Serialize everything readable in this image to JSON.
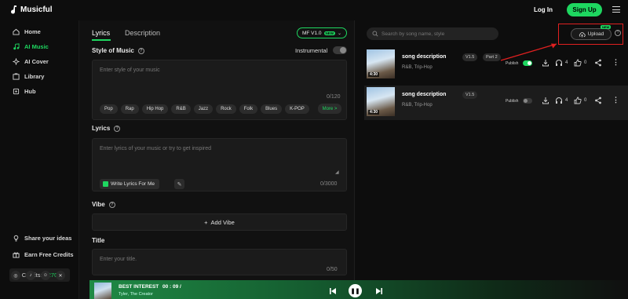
{
  "app": {
    "name": "Musicful"
  },
  "header": {
    "login": "Log In",
    "signup": "Sign Up"
  },
  "sidebar": {
    "items": [
      {
        "label": "Home",
        "icon": "home-icon",
        "active": false
      },
      {
        "label": "AI Music",
        "icon": "music-icon",
        "active": true
      },
      {
        "label": "AI Cover",
        "icon": "cover-icon",
        "active": false
      },
      {
        "label": "Library",
        "icon": "library-icon",
        "active": false
      },
      {
        "label": "Hub",
        "icon": "hub-icon",
        "active": false
      }
    ],
    "bottom": [
      {
        "label": "Share your ideas",
        "icon": "lightbulb-icon"
      },
      {
        "label": "Earn Free Credits",
        "icon": "gift-icon"
      }
    ],
    "credits_label": "Credits:",
    "credits_value": "2270",
    "socials": [
      "instagram-icon",
      "tiktok-icon",
      "discord-icon",
      "x-icon"
    ]
  },
  "form": {
    "tabs": {
      "lyrics": "Lyrics",
      "description": "Description"
    },
    "model": {
      "label": "MF V1.0",
      "badge": "NEW"
    },
    "style": {
      "label": "Style of Music",
      "instrumental": "Instrumental",
      "placeholder": "Enter style of your music",
      "counter": "0/120",
      "tags": [
        "Pop",
        "Rap",
        "Hip Hop",
        "R&B",
        "Jazz",
        "Rock",
        "Folk",
        "Blues",
        "K-POP"
      ],
      "more": "More >"
    },
    "lyrics": {
      "label": "Lyrics",
      "placeholder": "Enter lyrics of your music or try to get inspired",
      "write_button": "Write Lyrics For Me",
      "counter": "0/3000"
    },
    "vibe": {
      "label": "Vibe",
      "add": "Add Vibe"
    },
    "title": {
      "label": "Title",
      "placeholder": "Enter your title.",
      "counter": "0/50"
    }
  },
  "songs_panel": {
    "search_placeholder": "Search by song name, style",
    "upload": {
      "label": "Upload",
      "badge": "NEW"
    },
    "songs": [
      {
        "title": "song description",
        "version": "V1.5",
        "part": "Part 2",
        "genre": "R&B, Trip-Hop",
        "duration": "4:30",
        "publish_label": "Publish",
        "published": true,
        "listens": "4",
        "likes": "0"
      },
      {
        "title": "song description",
        "version": "V1.5",
        "part": "",
        "genre": "R&B, Trip-Hop",
        "duration": "4:30",
        "publish_label": "Publish",
        "published": false,
        "listens": "4",
        "likes": "0"
      }
    ]
  },
  "player": {
    "title": "BEST INTEREST",
    "time": "00 : 09 /",
    "artist": "Tyler, The Creator"
  },
  "colors": {
    "accent": "#1ed760",
    "annotation": "#e02020"
  }
}
